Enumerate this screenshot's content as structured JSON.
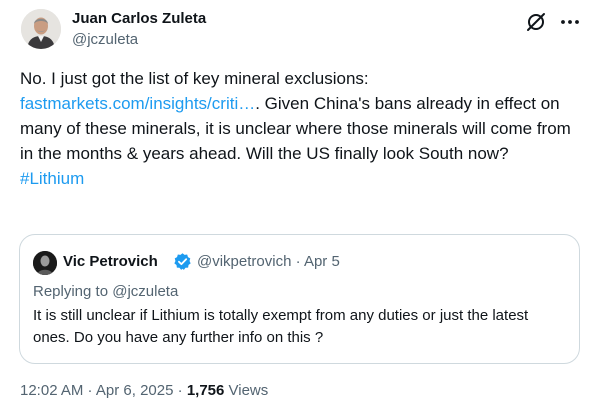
{
  "author": {
    "name": "Juan Carlos Zuleta",
    "handle": "@jczuleta"
  },
  "tweet": {
    "text_before_link": "No. I just got the list of key mineral exclusions: ",
    "link": "fastmarkets.com/insights/criti…",
    "text_after_link": ". Given China's bans already in effect on many of these minerals, it is unclear where those minerals will come from in the months & years ahead. Will the US finally look South now?",
    "hashtag": "#Lithium"
  },
  "quoted": {
    "name": "Vic Petrovich",
    "handle": "@vikpetrovich",
    "separator": " · ",
    "date": "Apr 5",
    "replying_label": "Replying to ",
    "replying_handle": "@jczuleta",
    "text": "It is still unclear if Lithium is totally exempt from any duties or just the latest ones. Do you have any further info on this ?"
  },
  "footer": {
    "time": "12:02 AM",
    "sep1": " · ",
    "date": "Apr 6, 2025",
    "sep2": " · ",
    "views_count": "1,756",
    "views_label": " Views"
  },
  "icons": {
    "grok": "grok-icon",
    "more": "more-icon",
    "verified": "verified-badge-icon"
  },
  "colors": {
    "link": "#1d9bf0",
    "secondary_text": "#536471",
    "border": "#cfd9de",
    "verified": "#1d9bf0"
  }
}
